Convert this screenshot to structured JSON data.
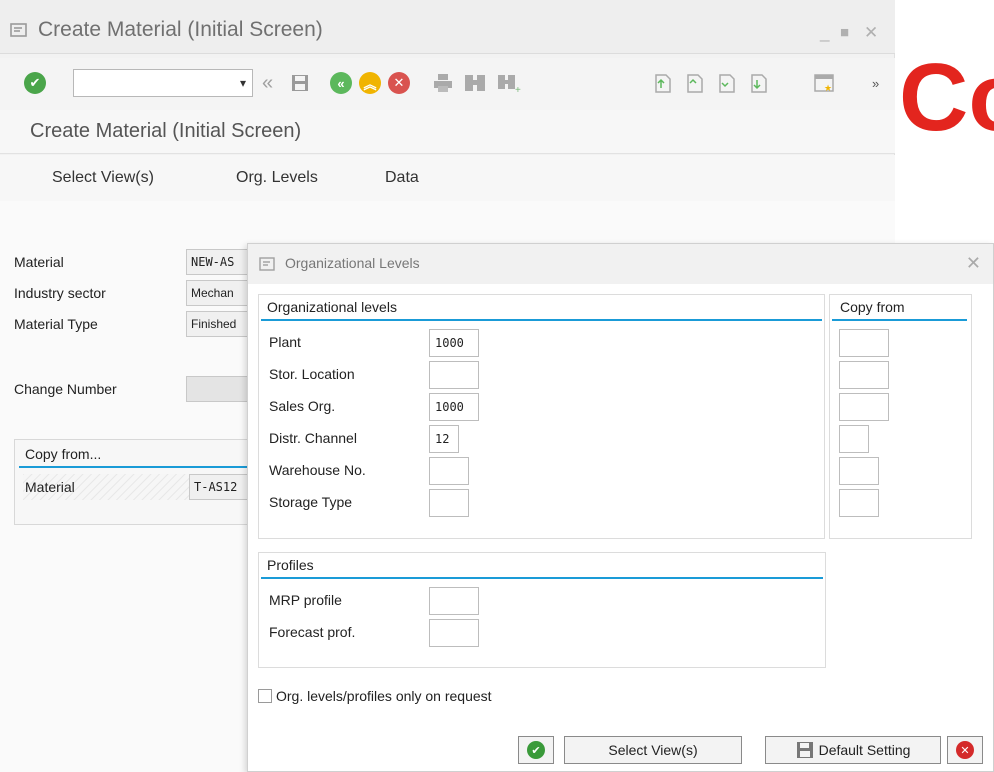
{
  "main_window": {
    "title": "Create Material (Initial Screen)",
    "screen_title": "Create Material (Initial Screen)",
    "menu": {
      "select_views": "Select View(s)",
      "org_levels": "Org. Levels",
      "data": "Data"
    },
    "fields": [
      {
        "label": "Material",
        "value": "NEW-AS"
      },
      {
        "label": "Industry sector",
        "value": "Mechan"
      },
      {
        "label": "Material Type",
        "value": "Finished"
      },
      {
        "label": "Change Number",
        "value": ""
      }
    ],
    "copy_from": {
      "heading": "Copy from...",
      "material_label": "Material",
      "material_value": "T-AS12"
    },
    "brand_logo_text": "Co"
  },
  "dialog": {
    "title": "Organizational Levels",
    "org_levels_heading": "Organizational levels",
    "copy_from_heading": "Copy from",
    "org_fields": [
      {
        "label": "Plant",
        "value": "1000"
      },
      {
        "label": "Stor. Location",
        "value": ""
      },
      {
        "label": "Sales Org.",
        "value": "1000"
      },
      {
        "label": "Distr. Channel",
        "value": "12"
      },
      {
        "label": "Warehouse No.",
        "value": ""
      },
      {
        "label": "Storage Type",
        "value": ""
      }
    ],
    "profiles_heading": "Profiles",
    "profile_fields": [
      {
        "label": "MRP profile",
        "value": ""
      },
      {
        "label": "Forecast prof.",
        "value": ""
      }
    ],
    "checkbox_label": "Org. levels/profiles only on request",
    "checkbox_checked": false,
    "buttons": {
      "select_views": "Select View(s)",
      "default_setting": "Default Setting"
    }
  },
  "colors": {
    "accent": "#1a9bd7",
    "ok_green": "#3a9a3a",
    "cancel_red": "#d42a2a",
    "logo_red": "#e3251e"
  }
}
